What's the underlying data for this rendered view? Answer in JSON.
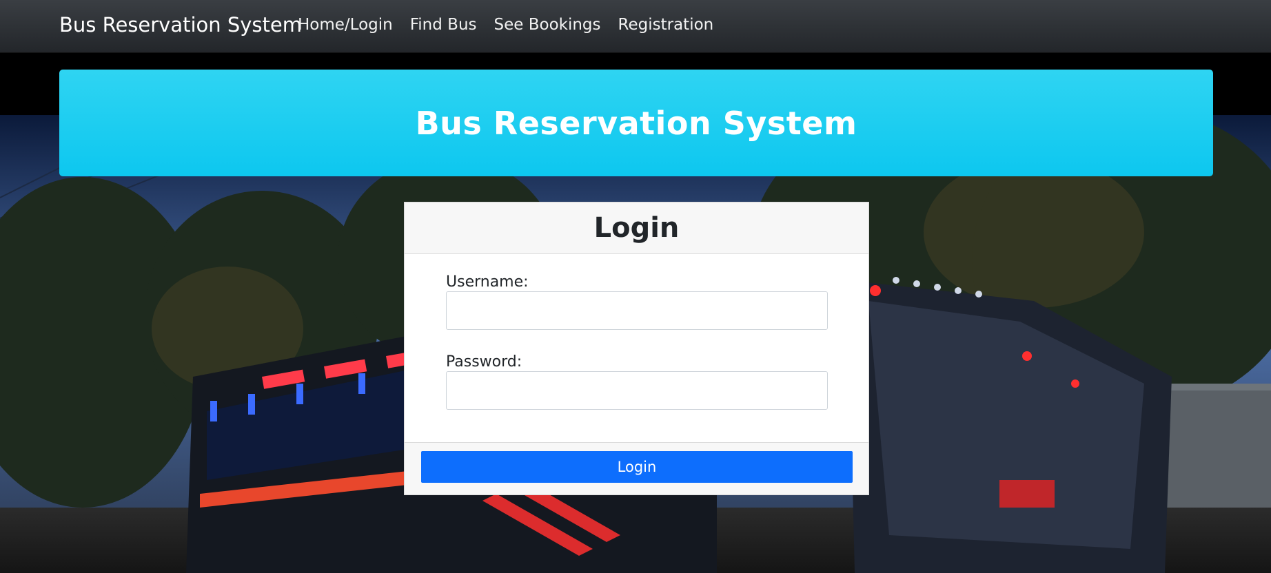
{
  "navbar": {
    "brand": "Bus Reservation System",
    "links": [
      {
        "label": "Home/Login"
      },
      {
        "label": "Find Bus"
      },
      {
        "label": "See Bookings"
      },
      {
        "label": "Registration"
      }
    ]
  },
  "banner": {
    "title": "Bus Reservation System"
  },
  "login": {
    "title": "Login",
    "username_label": "Username:",
    "username_value": "",
    "password_label": "Password:",
    "password_value": "",
    "button_label": "Login"
  },
  "colors": {
    "navbar": "#2b2e33",
    "banner": "#1fcff1",
    "primary_button": "#0d6efd"
  },
  "background": {
    "description_icon": "bus-photo-background"
  }
}
